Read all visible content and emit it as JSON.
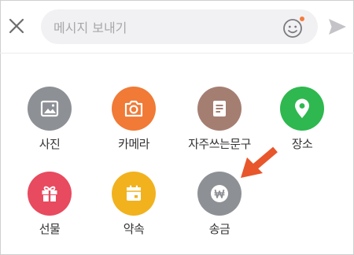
{
  "input": {
    "placeholder": "메시지 보내기",
    "value": ""
  },
  "icons": {
    "close": "close-icon",
    "emoji": "emoji-icon",
    "send": "send-icon"
  },
  "colors": {
    "emoji_notification_dot": "#f47b3c",
    "annotation_arrow": "#e8562c"
  },
  "menu": {
    "items": [
      {
        "label": "사진",
        "icon": "photo-icon",
        "color": "#8d9095"
      },
      {
        "label": "카메라",
        "icon": "camera-icon",
        "color": "#f07a36"
      },
      {
        "label": "자주쓰는문구",
        "icon": "document-icon",
        "color": "#a57e72"
      },
      {
        "label": "장소",
        "icon": "location-pin-icon",
        "color": "#2eb84f"
      },
      {
        "label": "선물",
        "icon": "gift-icon",
        "color": "#e84a5f"
      },
      {
        "label": "약속",
        "icon": "calendar-icon",
        "color": "#f1b21e"
      },
      {
        "label": "송금",
        "icon": "won-money-icon",
        "color": "#8d9095"
      }
    ]
  }
}
